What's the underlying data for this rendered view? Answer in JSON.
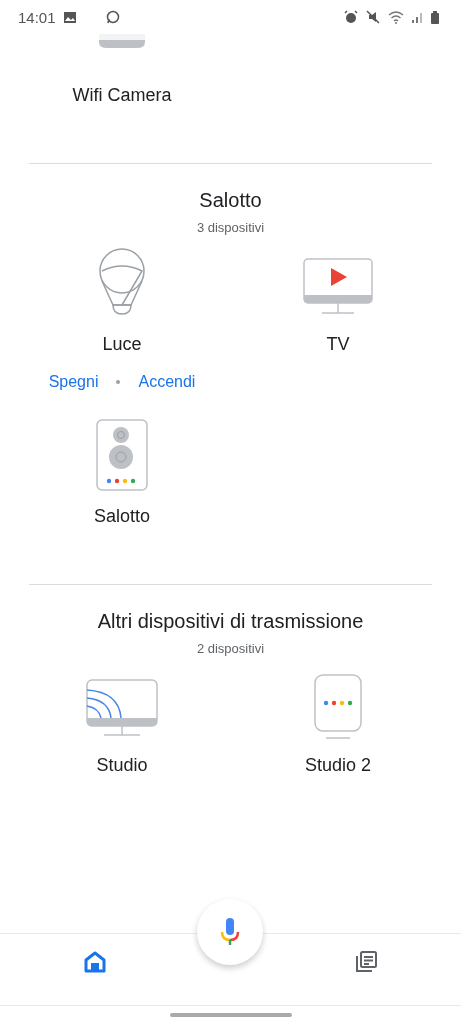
{
  "status_bar": {
    "time": "14:01"
  },
  "partial_device": {
    "name": "Wifi Camera",
    "kind": "camera"
  },
  "rooms": [
    {
      "title": "Salotto",
      "count": "3 dispositivi",
      "devices": [
        {
          "name": "Luce",
          "kind": "bulb",
          "actions": [
            "Spegni",
            "Accendi"
          ]
        },
        {
          "name": "TV",
          "kind": "tv"
        },
        {
          "name": "Salotto",
          "kind": "speaker"
        }
      ]
    },
    {
      "title": "Altri dispositivi di trasmissione",
      "count": "2 dispositivi",
      "devices": [
        {
          "name": "Studio",
          "kind": "cast-display"
        },
        {
          "name": "Studio 2",
          "kind": "smart-display"
        }
      ]
    }
  ],
  "nav": [
    {
      "kind": "home",
      "selected": true
    },
    {
      "kind": "feed",
      "selected": false
    }
  ]
}
